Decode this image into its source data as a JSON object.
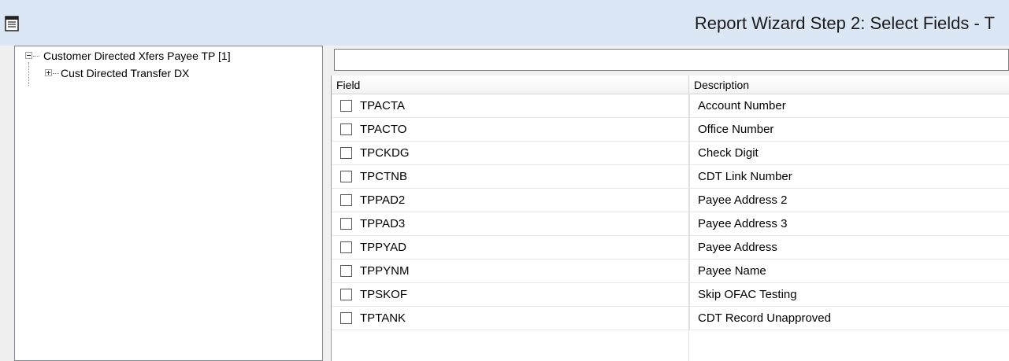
{
  "window": {
    "title": "Report Wizard Step 2:  Select Fields - T",
    "icon": "report-document-icon"
  },
  "tree": {
    "root": {
      "label": "Customer Directed Xfers Payee TP [1]",
      "state": "expanded",
      "children": [
        {
          "label": "Cust Directed Transfer DX",
          "state": "collapsed"
        }
      ]
    }
  },
  "filter": {
    "value": "",
    "placeholder": ""
  },
  "grid": {
    "columns": [
      "Field",
      "Description"
    ],
    "rows": [
      {
        "field": "TPACTA",
        "description": "Account Number",
        "checked": false
      },
      {
        "field": "TPACTO",
        "description": "Office Number",
        "checked": false
      },
      {
        "field": "TPCKDG",
        "description": "Check Digit",
        "checked": false
      },
      {
        "field": "TPCTNB",
        "description": "CDT Link Number",
        "checked": false
      },
      {
        "field": "TPPAD2",
        "description": "Payee Address 2",
        "checked": false
      },
      {
        "field": "TPPAD3",
        "description": "Payee Address 3",
        "checked": false
      },
      {
        "field": "TPPYAD",
        "description": "Payee Address",
        "checked": false
      },
      {
        "field": "TPPYNM",
        "description": "Payee Name",
        "checked": false
      },
      {
        "field": "TPSKOF",
        "description": "Skip OFAC Testing",
        "checked": false
      },
      {
        "field": "TPTANK",
        "description": "CDT Record Unapproved",
        "checked": false
      }
    ]
  }
}
